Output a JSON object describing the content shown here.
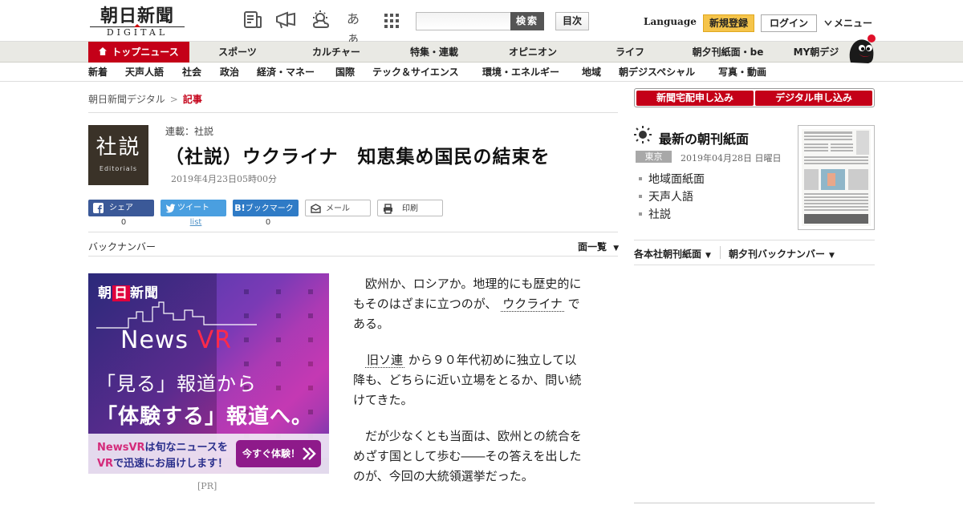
{
  "header": {
    "logo_main": "朝日新聞",
    "logo_sub": "DIGITAL",
    "icon_font_label": "あぁ",
    "search_button": "検索",
    "search_placeholder": "",
    "mokuji_button": "目次",
    "language": "Language",
    "register": "新規登録",
    "login": "ログイン",
    "menu": "メニュー"
  },
  "global_nav": [
    {
      "label": "トップニュース",
      "active": true
    },
    {
      "label": "スポーツ"
    },
    {
      "label": "カルチャー"
    },
    {
      "label": "特集・連載"
    },
    {
      "label": "オピニオン"
    },
    {
      "label": "ライフ"
    },
    {
      "label": "朝夕刊紙面・be"
    },
    {
      "label": "MY朝デジ"
    }
  ],
  "sub_nav": [
    "新着",
    "天声人語",
    "社会",
    "政治",
    "経済・マネー",
    "国際",
    "テック＆サイエンス",
    "環境・エネルギー",
    "地域",
    "朝デジスペシャル",
    "写真・動画"
  ],
  "breadcrumb": {
    "home": "朝日新聞デジタル",
    "sep": ">",
    "current": "記事"
  },
  "article": {
    "badge_main": "社説",
    "badge_sub": "Editorials",
    "series": "連載：社説",
    "title": "（社説）ウクライナ　知恵集め国民の結束を",
    "date": "2019年4月23日05時00分",
    "paragraphs": [
      {
        "lines": [
          "　欧州か、ロシアか。地理的にも歴史的に",
          "もそのはざまに立つのが、",
          "ウクライナ",
          "で",
          "ある。"
        ]
      },
      {
        "lines": [
          "旧ソ連",
          "から９０年代初めに独立して以",
          "降も、どちらに近い立場をとるか、問い続",
          "けてきた。"
        ]
      },
      {
        "lines": [
          "　だが少なくとも当面は、欧州との統合を",
          "めざす国として歩む――その答えを出した",
          "のが、今回の大統領選挙だった。"
        ]
      }
    ]
  },
  "share": {
    "facebook": "シェア",
    "facebook_count": "0",
    "twitter": "ツイート",
    "twitter_count": "list",
    "hatena": "ブックマーク",
    "hatena_count": "0",
    "mail": "メール",
    "print": "印刷"
  },
  "backnumber": {
    "label": "バックナンバー",
    "list": "面一覧"
  },
  "ad": {
    "brand_pre": "朝",
    "brand_mid": "日",
    "brand_post": "新聞",
    "news": "News ",
    "vr": "VR",
    "line1": "「見る」報道から",
    "line2": "「体験する」報道へ。",
    "b1_hl": "NewsVR",
    "b1_rest": "は旬なニュースを",
    "b2_hl": "VR",
    "b2_rest": "で迅速にお届けします！",
    "cta": "今すぐ体験！",
    "pr": "[PR]"
  },
  "right": {
    "btn_home": "新聞宅配申し込み",
    "btn_digital": "デジタル申し込み",
    "chokan_title": "最新の朝刊紙面",
    "region": "東京",
    "date": "2019年04月28日 日曜日",
    "links": [
      "地域面紙面",
      "天声人語",
      "社説"
    ],
    "sel1": "各本社朝刊紙面",
    "sel2": "朝夕刊バックナンバー"
  }
}
